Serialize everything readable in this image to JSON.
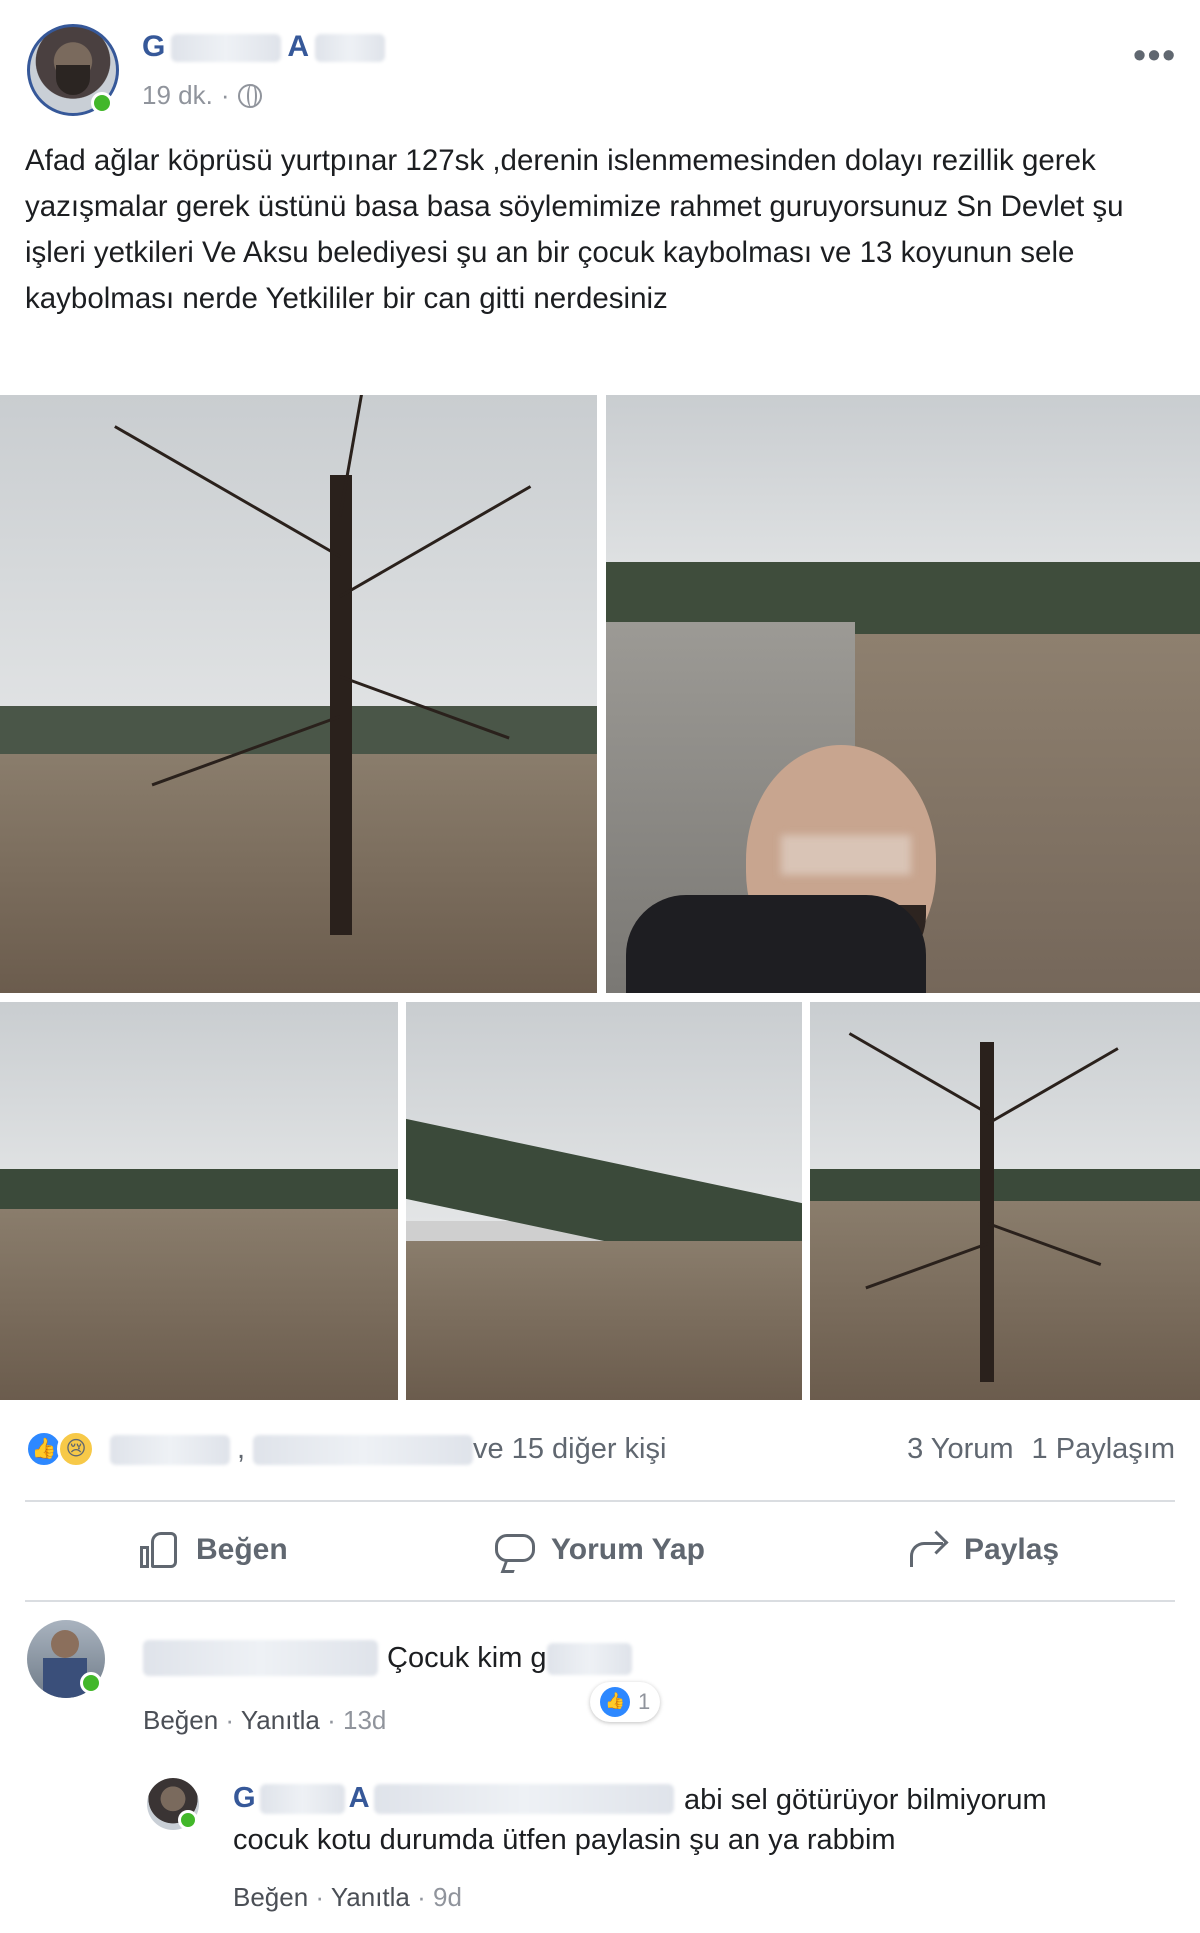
{
  "post": {
    "author_first_initial": "G",
    "author_last_initial": "A",
    "time": "19 dk.",
    "separator": "·",
    "more_label": "•••",
    "text": "Afad ağlar köprüsü yurtpınar 127sk ,derenin islenmemesinden dolayı rezillik gerek yazışmalar gerek üstünü basa basa söylemimize rahmet guruyorsunuz Sn Devlet şu işleri yetkileri Ve Aksu belediyesi şu an bir çocuk kaybolması ve 13 koyunun sele kaybolması nerde Yetkililer bir can gitti nerdesiniz"
  },
  "reactions": {
    "comma": ",",
    "others_text": "ve 15 diğer kişi",
    "comment_count": "3 Yorum",
    "share_count": "1 Paylaşım",
    "icons": [
      "like-icon",
      "sad-icon"
    ]
  },
  "actions": {
    "like_label": "Beğen",
    "comment_label": "Yorum Yap",
    "share_label": "Paylaş"
  },
  "comments": [
    {
      "text": "Çocuk kim g",
      "like_label": "Beğen",
      "reply_label": "Yanıtla",
      "time": "13d",
      "sep": "·",
      "reaction_count": "1"
    }
  ],
  "reply": {
    "name_first_initial": "G",
    "name_last_initial": "A",
    "text_line1": "abi sel götürüyor bilmiyorum",
    "text_line2": "cocuk kotu durumda ütfen paylasin şu an ya rabbim",
    "like_label": "Beğen",
    "reply_label": "Yanıtla",
    "time": "9d",
    "sep": "·"
  },
  "colors": {
    "link_blue": "#365899",
    "like_blue": "#2d88ff",
    "online_green": "#42b72a",
    "muted_text": "#90949c"
  }
}
